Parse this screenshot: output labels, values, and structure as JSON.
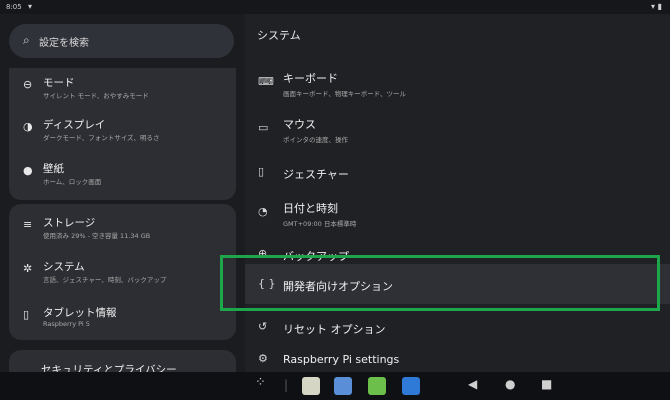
{
  "status": {
    "time": "8:05",
    "wifi_icon": "wifi-icon",
    "right_icons": "wifi-battery"
  },
  "search": {
    "placeholder": "設定を検索"
  },
  "left_items": [
    {
      "name": "mode",
      "title": "モード",
      "subtitle": "サイレント モード、おやすみモード",
      "icon": "mode-icon"
    },
    {
      "name": "display",
      "title": "ディスプレイ",
      "subtitle": "ダークモード、フォントサイズ、明るさ",
      "icon": "display-icon"
    },
    {
      "name": "wallpaper",
      "title": "壁紙",
      "subtitle": "ホーム、ロック画面",
      "icon": "palette-icon"
    },
    {
      "name": "storage",
      "title": "ストレージ",
      "subtitle": "使用済み 29% - 空き容量 11.34 GB",
      "icon": "storage-icon"
    },
    {
      "name": "system",
      "title": "システム",
      "subtitle": "言語、ジェスチャー、時刻、バックアップ",
      "icon": "gear-icon"
    },
    {
      "name": "tablet-info",
      "title": "タブレット情報",
      "subtitle": "Raspberry Pi 5",
      "icon": "tablet-icon"
    },
    {
      "name": "security",
      "title": "セキュリティとプライバシー",
      "subtitle": "",
      "icon": ""
    }
  ],
  "right_pane": {
    "title": "システム",
    "items": [
      {
        "name": "keyboard",
        "title": "キーボード",
        "subtitle": "画面キーボード、物理キーボード、ツール",
        "icon": "keyboard-icon"
      },
      {
        "name": "mouse",
        "title": "マウス",
        "subtitle": "ポインタの速度、操作",
        "icon": "mouse-icon"
      },
      {
        "name": "gestures",
        "title": "ジェスチャー",
        "subtitle": "",
        "icon": "phone-icon"
      },
      {
        "name": "date-time",
        "title": "日付と時刻",
        "subtitle": "GMT+09:00 日本標準時",
        "icon": "clock-icon"
      },
      {
        "name": "backup",
        "title": "バックアップ",
        "subtitle": "",
        "icon": "backup-icon"
      },
      {
        "name": "developer",
        "title": "開発者向けオプション",
        "subtitle": "",
        "icon": "braces-icon"
      },
      {
        "name": "reset",
        "title": "リセット オプション",
        "subtitle": "",
        "icon": "history-icon"
      },
      {
        "name": "raspberry-settings",
        "title": "Raspberry Pi settings",
        "subtitle": "",
        "icon": "settings-gear-icon"
      }
    ]
  },
  "navbar": {
    "back": "◀",
    "home": "●",
    "recents": "■"
  },
  "colors": {
    "highlight": "#1ea64a",
    "left_bg": "#1b1c1f",
    "right_bg": "#202125",
    "card_bg": "#2c2e33"
  }
}
